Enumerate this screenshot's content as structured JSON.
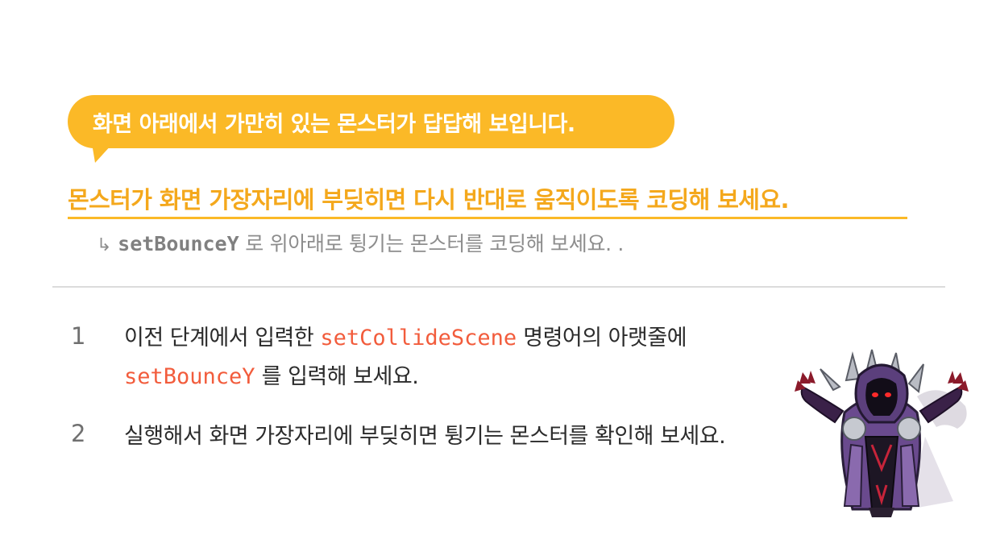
{
  "bubble": {
    "text": "화면 아래에서 가만히 있는 몬스터가 답답해 보입니다."
  },
  "mission": {
    "text": "몬스터가 화면 가장자리에 부딪히면 다시 반대로 움직이도록 코딩해 보세요."
  },
  "hint": {
    "arrow": "↳",
    "code": "setBounceY",
    "text": " 로 위아래로 튕기는 몬스터를 코딩해 보세요. ."
  },
  "steps": [
    {
      "number": "1",
      "line1_before": "이전 단계에서 입력한 ",
      "line1_code": "setCollideScene",
      "line1_after": " 명령어의 아랫줄에",
      "line2_code": "setBounceY",
      "line2_after": " 를 입력해 보세요."
    },
    {
      "number": "2",
      "text": "실행해서 화면 가장자리에 부딪히면 튕기는 몬스터를 확인해 보세요."
    }
  ],
  "colors": {
    "accent_yellow": "#fbb927",
    "mission_text": "#f4a81c",
    "code_red": "#f25c3c",
    "hint_gray": "#8d8d8d"
  },
  "icons": {
    "monster": "hooded-reaper-monster"
  }
}
